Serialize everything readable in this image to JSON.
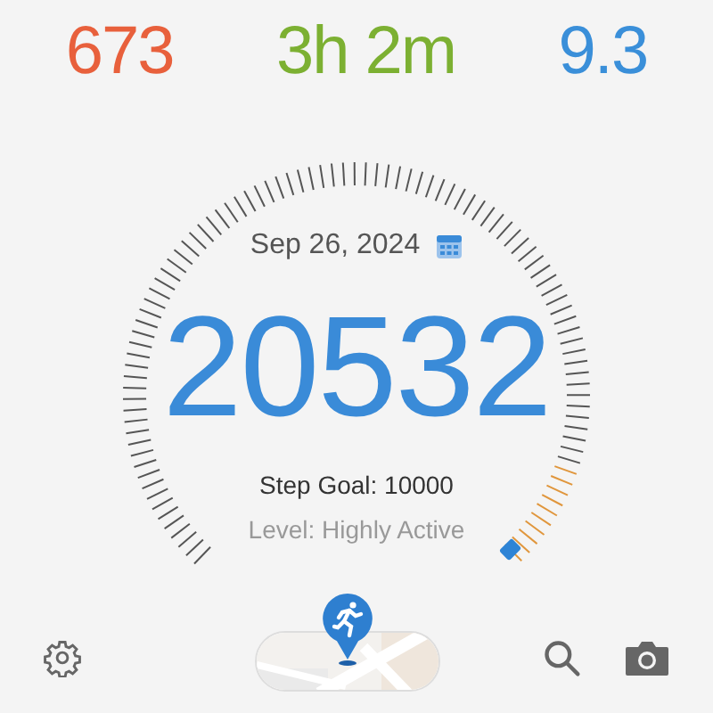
{
  "stats": [
    {
      "value": "673",
      "color": "#e8603c"
    },
    {
      "value": "3h 2m",
      "color": "#7cb032"
    },
    {
      "value": "9.3",
      "color": "#3a8fd9"
    }
  ],
  "date": "Sep 26, 2024",
  "steps": "20532",
  "goal": "Step Goal: 10000",
  "activity_level": "Level: Highly Active"
}
